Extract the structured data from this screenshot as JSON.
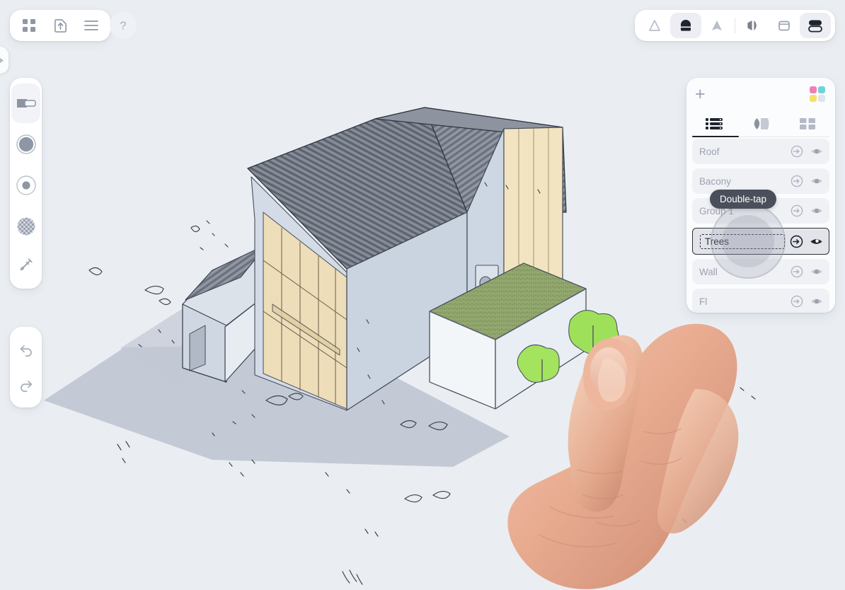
{
  "app": {
    "background_color": "#eaeef2",
    "panel_color": "#fbfcfe",
    "accent_color": "#1d2330"
  },
  "toolbar_left": {
    "buttons": [
      {
        "label": "Gallery",
        "icon": "grid-icon"
      },
      {
        "label": "Export",
        "icon": "export-icon"
      },
      {
        "label": "Menu",
        "icon": "hamburger-icon"
      }
    ],
    "help_label": "?"
  },
  "toolbar_right": {
    "buttons": [
      {
        "label": "Perspective Camera",
        "icon": "cone-outline-icon",
        "active": false
      },
      {
        "label": "Orthographic View",
        "icon": "arch-solid-icon",
        "active": true
      },
      {
        "label": "Field of View",
        "icon": "cone-solid-icon",
        "active": false
      },
      {
        "label": "Mirror",
        "icon": "mirror-icon",
        "active": false
      },
      {
        "label": "Frame",
        "icon": "frame-icon",
        "active": false
      },
      {
        "label": "Layers Panel",
        "icon": "stack-icon",
        "active": true
      }
    ]
  },
  "tool_rail": {
    "edge_tab": {
      "label": "Expand sidebar",
      "icon": "chevron-right-icon"
    },
    "tools": [
      {
        "label": "Eraser",
        "icon": "eraser-icon",
        "selected": true
      },
      {
        "label": "Brush",
        "icon": "brush-dot-icon",
        "selected": false
      },
      {
        "label": "Hardness",
        "icon": "hardness-icon",
        "selected": false
      },
      {
        "label": "Opacity",
        "icon": "opacity-icon",
        "selected": false
      },
      {
        "label": "Color Picker",
        "icon": "eyedropper-icon",
        "selected": false
      }
    ],
    "history": [
      {
        "label": "Undo",
        "icon": "undo-icon"
      },
      {
        "label": "Redo",
        "icon": "redo-icon"
      }
    ]
  },
  "layers_panel": {
    "add_label": "+",
    "add_name": "Add layer",
    "palette_name": "Color palette",
    "palette_colors": [
      "#f07fb8",
      "#6fd4d8",
      "#f5e06a",
      "#dfe3ea"
    ],
    "tabs": [
      {
        "label": "Layers",
        "icon": "list-icon",
        "active": true
      },
      {
        "label": "Materials",
        "icon": "shapes-icon",
        "active": false
      },
      {
        "label": "Assets",
        "icon": "grid4-icon",
        "active": false
      }
    ],
    "rows": [
      {
        "name": "Roof",
        "selected": false,
        "goto_icon": "arrow-in-circle-icon",
        "visibility_icon": "eye-icon",
        "visible": true
      },
      {
        "name": "Bacony",
        "selected": false,
        "goto_icon": "arrow-in-circle-icon",
        "visibility_icon": "eye-icon",
        "visible": true
      },
      {
        "name": "Group 1",
        "selected": false,
        "goto_icon": "arrow-in-circle-icon",
        "visibility_icon": "eye-icon",
        "visible": true
      },
      {
        "name": "Trees",
        "selected": true,
        "goto_icon": "arrow-in-circle-icon",
        "visibility_icon": "eye-icon",
        "visible": true
      },
      {
        "name": "Wall",
        "selected": false,
        "goto_icon": "arrow-in-circle-icon",
        "visibility_icon": "eye-icon",
        "visible": true
      },
      {
        "name": "Fl",
        "selected": false,
        "goto_icon": "arrow-in-circle-icon",
        "visibility_icon": "eye-icon",
        "visible": true
      }
    ]
  },
  "tooltip": {
    "text": "Double-tap"
  },
  "scene": {
    "name": "architectural-3d-model",
    "description": "Isometric sketch-style 3D house model with pitched metal roof, glazed timber facade, green planter roof and trees",
    "colors": {
      "wall": "#ced8e2",
      "wall_light": "#f4f7fa",
      "roof": "#7a808c",
      "glass": "#f3dfb4",
      "timber": "#f6e6c2",
      "grass": "#8ba06a",
      "foliage": "#9fe05a",
      "shadow": "#b9bfcb"
    }
  }
}
